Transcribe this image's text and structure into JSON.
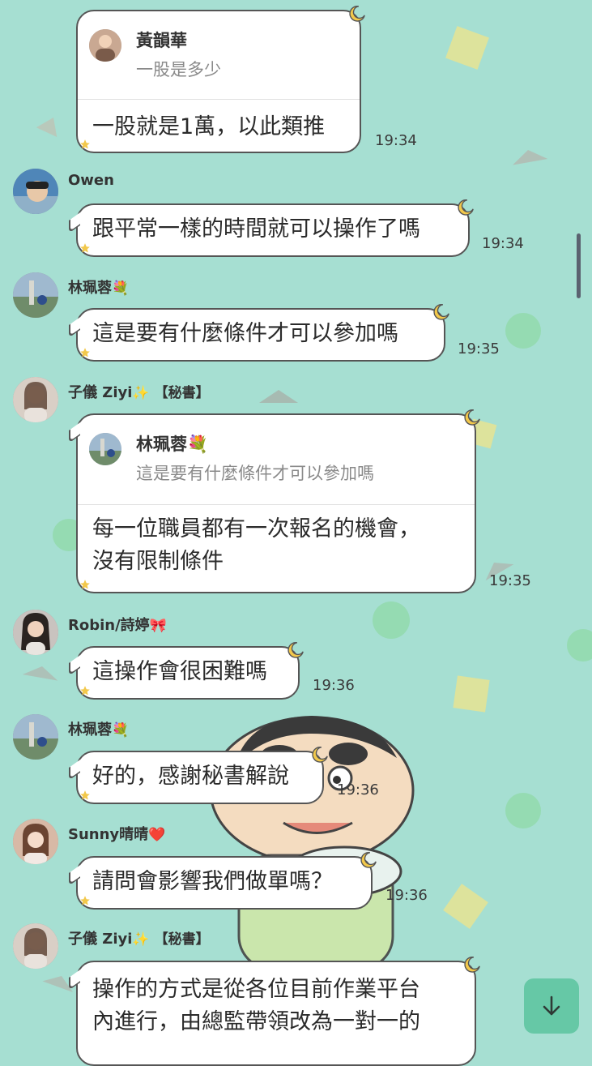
{
  "messages": [
    {
      "id": "m1",
      "reply": {
        "name": "黃韻華",
        "quote": "一股是多少"
      },
      "lines": [
        "一股就是1萬，以此類推"
      ],
      "time": "19:34"
    },
    {
      "id": "m2",
      "sender": "Owen",
      "lines": [
        "跟平常一樣的時間就可以操作了嗎"
      ],
      "time": "19:34"
    },
    {
      "id": "m3",
      "sender": "林珮蓉",
      "sender_emoji": "💐",
      "lines": [
        "這是要有什麼條件才可以參加嗎"
      ],
      "time": "19:35"
    },
    {
      "id": "m4",
      "sender": "子儀 Ziyi",
      "sender_emoji": "✨",
      "role": "【秘書】",
      "reply": {
        "name": "林珮蓉💐",
        "quote": "這是要有什麼條件才可以參加嗎"
      },
      "lines": [
        "每一位職員都有一次報名的機會，",
        "沒有限制條件"
      ],
      "time": "19:35"
    },
    {
      "id": "m5",
      "sender": "Robin/詩婷",
      "sender_emoji": "🎀",
      "lines": [
        "這操作會很困難嗎"
      ],
      "time": "19:36"
    },
    {
      "id": "m6",
      "sender": "林珮蓉",
      "sender_emoji": "💐",
      "lines": [
        "好的，感謝秘書解說"
      ],
      "time": "19:36"
    },
    {
      "id": "m7",
      "sender": "Sunny晴晴",
      "sender_emoji": "❤️",
      "lines": [
        "請問會影響我們做單嗎？"
      ],
      "time": "19:36"
    },
    {
      "id": "m8",
      "sender": "子儀 Ziyi",
      "sender_emoji": "✨",
      "role": "【秘書】",
      "lines": [
        "操作的方式是從各位目前作業平台",
        "內進行，由總監帶領改為一對一的"
      ],
      "time": ""
    }
  ],
  "icons": {
    "scroll_down": "arrow-down-icon",
    "bubble_decoration": "crescent-moon-icon",
    "bubble_star": "star-icon"
  },
  "colors": {
    "background": "#a6dfd2",
    "scroll_button": "#66c8a6"
  }
}
